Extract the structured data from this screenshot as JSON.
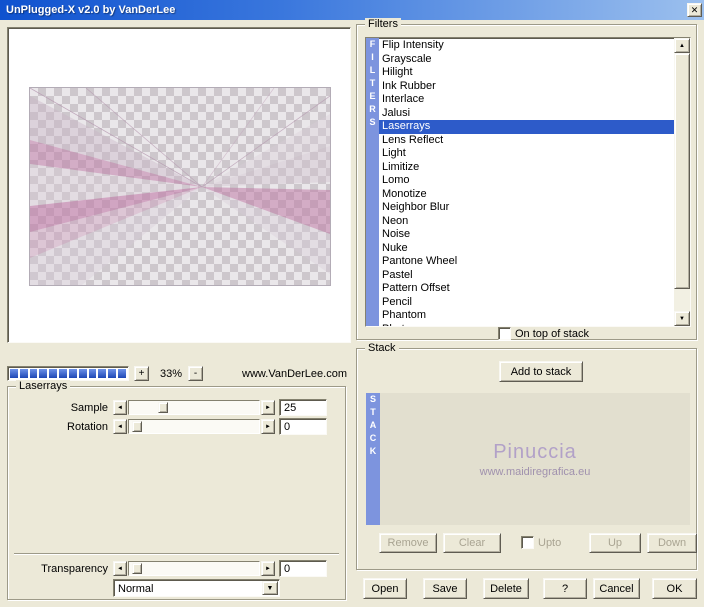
{
  "window": {
    "title": "UnPlugged-X v2.0 by VanDerLee"
  },
  "icons": {
    "close": "✕",
    "arrow_up": "▲",
    "arrow_down": "▼",
    "arrow_left": "◄",
    "arrow_right": "►",
    "chevron_down": "▼"
  },
  "preview": {
    "progress_segments": 12,
    "zoom_plus": "+",
    "zoom_value": "33%",
    "zoom_minus": "-",
    "website": "www.VanDerLee.com"
  },
  "params": {
    "group_label": "Laserrays",
    "sample_label": "Sample",
    "sample_value": "25",
    "rotation_label": "Rotation",
    "rotation_value": "0",
    "transparency_label": "Transparency",
    "transparency_value": "0",
    "blend_mode": "Normal"
  },
  "filters": {
    "group_label": "Filters",
    "strip_letters": "FILTERS",
    "selected": "Laserrays",
    "on_top_label": "On top of stack",
    "items": [
      "Flip Intensity",
      "Grayscale",
      "Hilight",
      "Ink Rubber",
      "Interlace",
      "Jalusi",
      "Laserrays",
      "Lens Reflect",
      "Light",
      "Limitize",
      "Lomo",
      "Monotize",
      "Neighbor Blur",
      "Neon",
      "Noise",
      "Nuke",
      "Pantone Wheel",
      "Pastel",
      "Pattern Offset",
      "Pencil",
      "Phantom",
      "Photocopy"
    ]
  },
  "stack": {
    "group_label": "Stack",
    "add_button": "Add to stack",
    "strip_letters": "STACK",
    "watermark_title": "Pinuccia",
    "watermark_url": "www.maidiregrafica.eu",
    "remove_button": "Remove",
    "clear_button": "Clear",
    "upto_label": "Upto",
    "up_button": "Up",
    "down_button": "Down"
  },
  "footer": {
    "open": "Open",
    "save": "Save",
    "delete": "Delete",
    "help": "?",
    "cancel": "Cancel",
    "ok": "OK"
  },
  "colors": {
    "dialog_bg": "#ece9d8",
    "titlebar_blue": "#0f52cf",
    "selection_blue": "#2d5bc9",
    "strip_blue": "#7d94de",
    "ray_pink": "#bf7aa6"
  }
}
